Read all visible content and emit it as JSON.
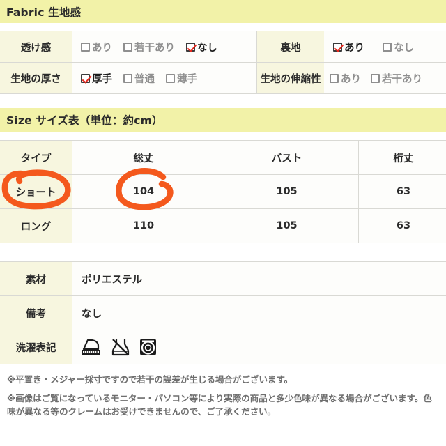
{
  "fabric_section": {
    "title": "Fabric  生地感",
    "rows": [
      {
        "left_label": "透け感",
        "left_options": [
          {
            "label": "あり",
            "checked": false
          },
          {
            "label": "若干あり",
            "checked": false
          },
          {
            "label": "なし",
            "checked": true
          }
        ],
        "right_label": "裏地",
        "right_options": [
          {
            "label": "あり",
            "checked": true
          },
          {
            "label": "なし",
            "checked": false
          }
        ]
      },
      {
        "left_label": "生地の厚さ",
        "left_options": [
          {
            "label": "厚手",
            "checked": true
          },
          {
            "label": "普通",
            "checked": false
          },
          {
            "label": "薄手",
            "checked": false
          }
        ],
        "right_label": "生地の伸縮性",
        "right_options": [
          {
            "label": "あり",
            "checked": false
          },
          {
            "label": "若干あり",
            "checked": false
          }
        ]
      }
    ]
  },
  "size_section": {
    "title": "Size  サイズ表（単位：約cm）",
    "headers": [
      "タイプ",
      "総丈",
      "バスト",
      "桁丈"
    ],
    "rows": [
      [
        "ショート",
        "104",
        "105",
        "63"
      ],
      [
        "ロング",
        "110",
        "105",
        "63"
      ]
    ]
  },
  "material_section": {
    "rows": [
      {
        "label": "素材",
        "value": "ポリエステル"
      },
      {
        "label": "備考",
        "value": "なし"
      }
    ],
    "care_label": "洗濯表記",
    "care_icons": [
      "iron-icon",
      "do-not-wring-icon",
      "tumble-dry-icon"
    ]
  },
  "notes": [
    "※平置き・メジャー採寸ですので若干の誤差が生じる場合がございます。",
    "※画像はご覧になっているモニター・パソコン等により実際の商品と多少色味が異なる場合がございます。色味が異なる等のクレームはお受けできませんので、ご了承ください。"
  ],
  "annotations": {
    "accent_color": "#f4591d",
    "circled": [
      "ショート",
      "104"
    ]
  }
}
